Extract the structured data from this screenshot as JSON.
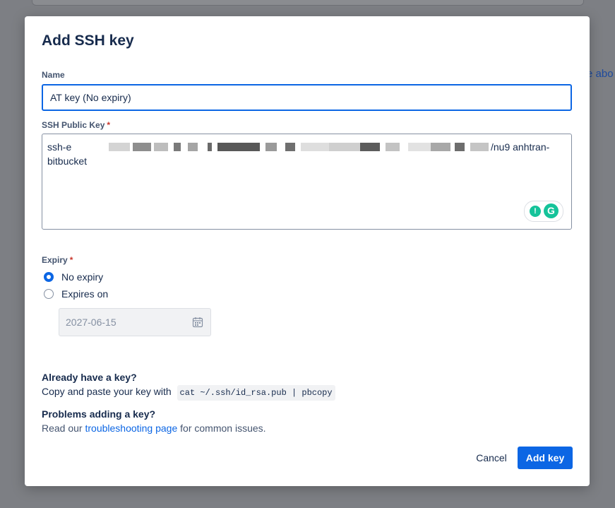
{
  "background": {
    "partial_link": "re abo"
  },
  "modal": {
    "title": "Add SSH key",
    "name_field": {
      "label": "Name",
      "value": "AT key (No expiry)"
    },
    "key_field": {
      "label": "SSH Public Key",
      "required_mark": "*",
      "value_start": "ssh-e",
      "value_end": "/nu9 anhtran-",
      "value_line2": "bitbucket"
    },
    "expiry": {
      "label": "Expiry",
      "required_mark": "*",
      "options": [
        {
          "label": "No expiry",
          "selected": true
        },
        {
          "label": "Expires on",
          "selected": false
        }
      ],
      "date_value": "2027-06-15"
    },
    "help": {
      "have_key_title": "Already have a key?",
      "have_key_text": "Copy and paste your key with",
      "have_key_command": "cat ~/.ssh/id_rsa.pub | pbcopy",
      "problems_title": "Problems adding a key?",
      "problems_prefix": "Read our",
      "problems_link": "troubleshooting page",
      "problems_suffix": "for common issues."
    },
    "buttons": {
      "cancel": "Cancel",
      "add": "Add key"
    }
  },
  "colors": {
    "primary": "#0c66e4",
    "required": "#c9372c",
    "grammarly": "#15c39a"
  },
  "icons": {
    "calendar": "calendar-icon",
    "grammarly": "grammarly-icon"
  }
}
